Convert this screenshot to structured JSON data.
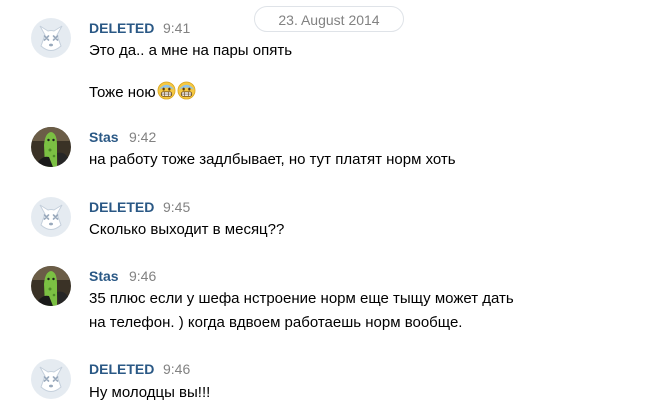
{
  "date_separator": "23. August 2014",
  "messages": [
    {
      "author": "DELETED",
      "time": "9:41",
      "avatar": "deleted-user-dog-icon",
      "lines": [
        "Это да.. а мне на пары опять",
        "Тоже ною"
      ],
      "emoji": [
        "grimacing-sweat-emoji",
        "grimacing-sweat-emoji"
      ]
    },
    {
      "author": "Stas",
      "time": "9:42",
      "avatar": "user-photo",
      "lines": [
        "на работу тоже задлбывает, но тут платят норм хоть"
      ]
    },
    {
      "author": "DELETED",
      "time": "9:45",
      "avatar": "deleted-user-dog-icon",
      "lines": [
        "Сколько выходит в месяц??"
      ]
    },
    {
      "author": "Stas",
      "time": "9:46",
      "avatar": "user-photo",
      "lines": [
        "35 плюс если у шефа нстроение норм еще тыщу может дать",
        "на телефон. ) когда вдвоем работаешь норм вообще."
      ]
    },
    {
      "author": "DELETED",
      "time": "9:46",
      "avatar": "deleted-user-dog-icon",
      "lines": [
        "Ну молодцы вы!!!"
      ]
    }
  ],
  "colors": {
    "author_name": "#2a5885",
    "timestamp": "#828282",
    "message_text": "#000000",
    "deleted_avatar_bg": "#e5ebf1",
    "deleted_avatar_fg": "#b2c0d1"
  }
}
